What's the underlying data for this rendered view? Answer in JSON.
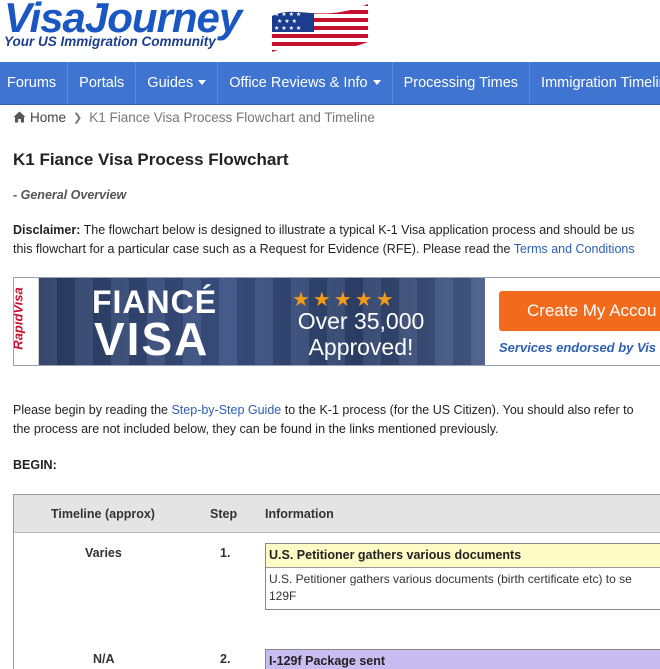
{
  "site": {
    "logo_text": "VisaJourney",
    "tagline": "Your US Immigration Community"
  },
  "nav": {
    "items": [
      {
        "label": "Forums",
        "dropdown": false
      },
      {
        "label": "Portals",
        "dropdown": false
      },
      {
        "label": "Guides",
        "dropdown": true
      },
      {
        "label": "Office Reviews & Info",
        "dropdown": true
      },
      {
        "label": "Processing Times",
        "dropdown": false
      },
      {
        "label": "Immigration Timelines",
        "dropdown": false
      }
    ]
  },
  "breadcrumb": {
    "home": "Home",
    "current": "K1 Fiance Visa Process Flowchart and Timeline"
  },
  "page": {
    "title": "K1 Fiance Visa Process Flowchart",
    "subtitle": "- General Overview",
    "disclaimer_label": "Disclaimer:",
    "disclaimer_line1": " The flowchart below is designed to illustrate a typical K-1 Visa application process and should be us",
    "disclaimer_line2": "this flowchart for a particular case such as a Request for Evidence (RFE). Please read the ",
    "terms_link": "Terms and Conditions",
    "intro_line1_a": "Please begin by reading the ",
    "intro_link": "Step-by-Step Guide",
    "intro_line1_b": " to the K-1 process (for the US Citizen). You should also refer to",
    "intro_line2": "the process are not included below, they can be found in the links mentioned previously.",
    "begin": "BEGIN:"
  },
  "banner": {
    "brand": "RapidVisa",
    "fiance": "FIANCÉ",
    "visa": "VISA",
    "stars": "★★★★★",
    "over_line1": "Over 35,000",
    "over_line2": "Approved!",
    "cta": "Create My Accou",
    "endorsed": "Services endorsed by Vis"
  },
  "table": {
    "headers": {
      "timeline": "Timeline (approx)",
      "step": "Step",
      "information": "Information"
    },
    "rows": [
      {
        "timeline": "Varies",
        "step": "1.",
        "title": "U.S. Petitioner gathers various documents",
        "body_line1": "U.S. Petitioner gathers various documents (birth certificate etc) to se",
        "body_line2": "129F",
        "color": "#fefcc4"
      },
      {
        "timeline": "N/A",
        "step": "2.",
        "title": "I-129f Package sent",
        "color": "#c7bdf0"
      }
    ]
  },
  "colors": {
    "navbar": "#3f74d0",
    "link": "#2c5fb5",
    "cta": "#f26b1d"
  }
}
